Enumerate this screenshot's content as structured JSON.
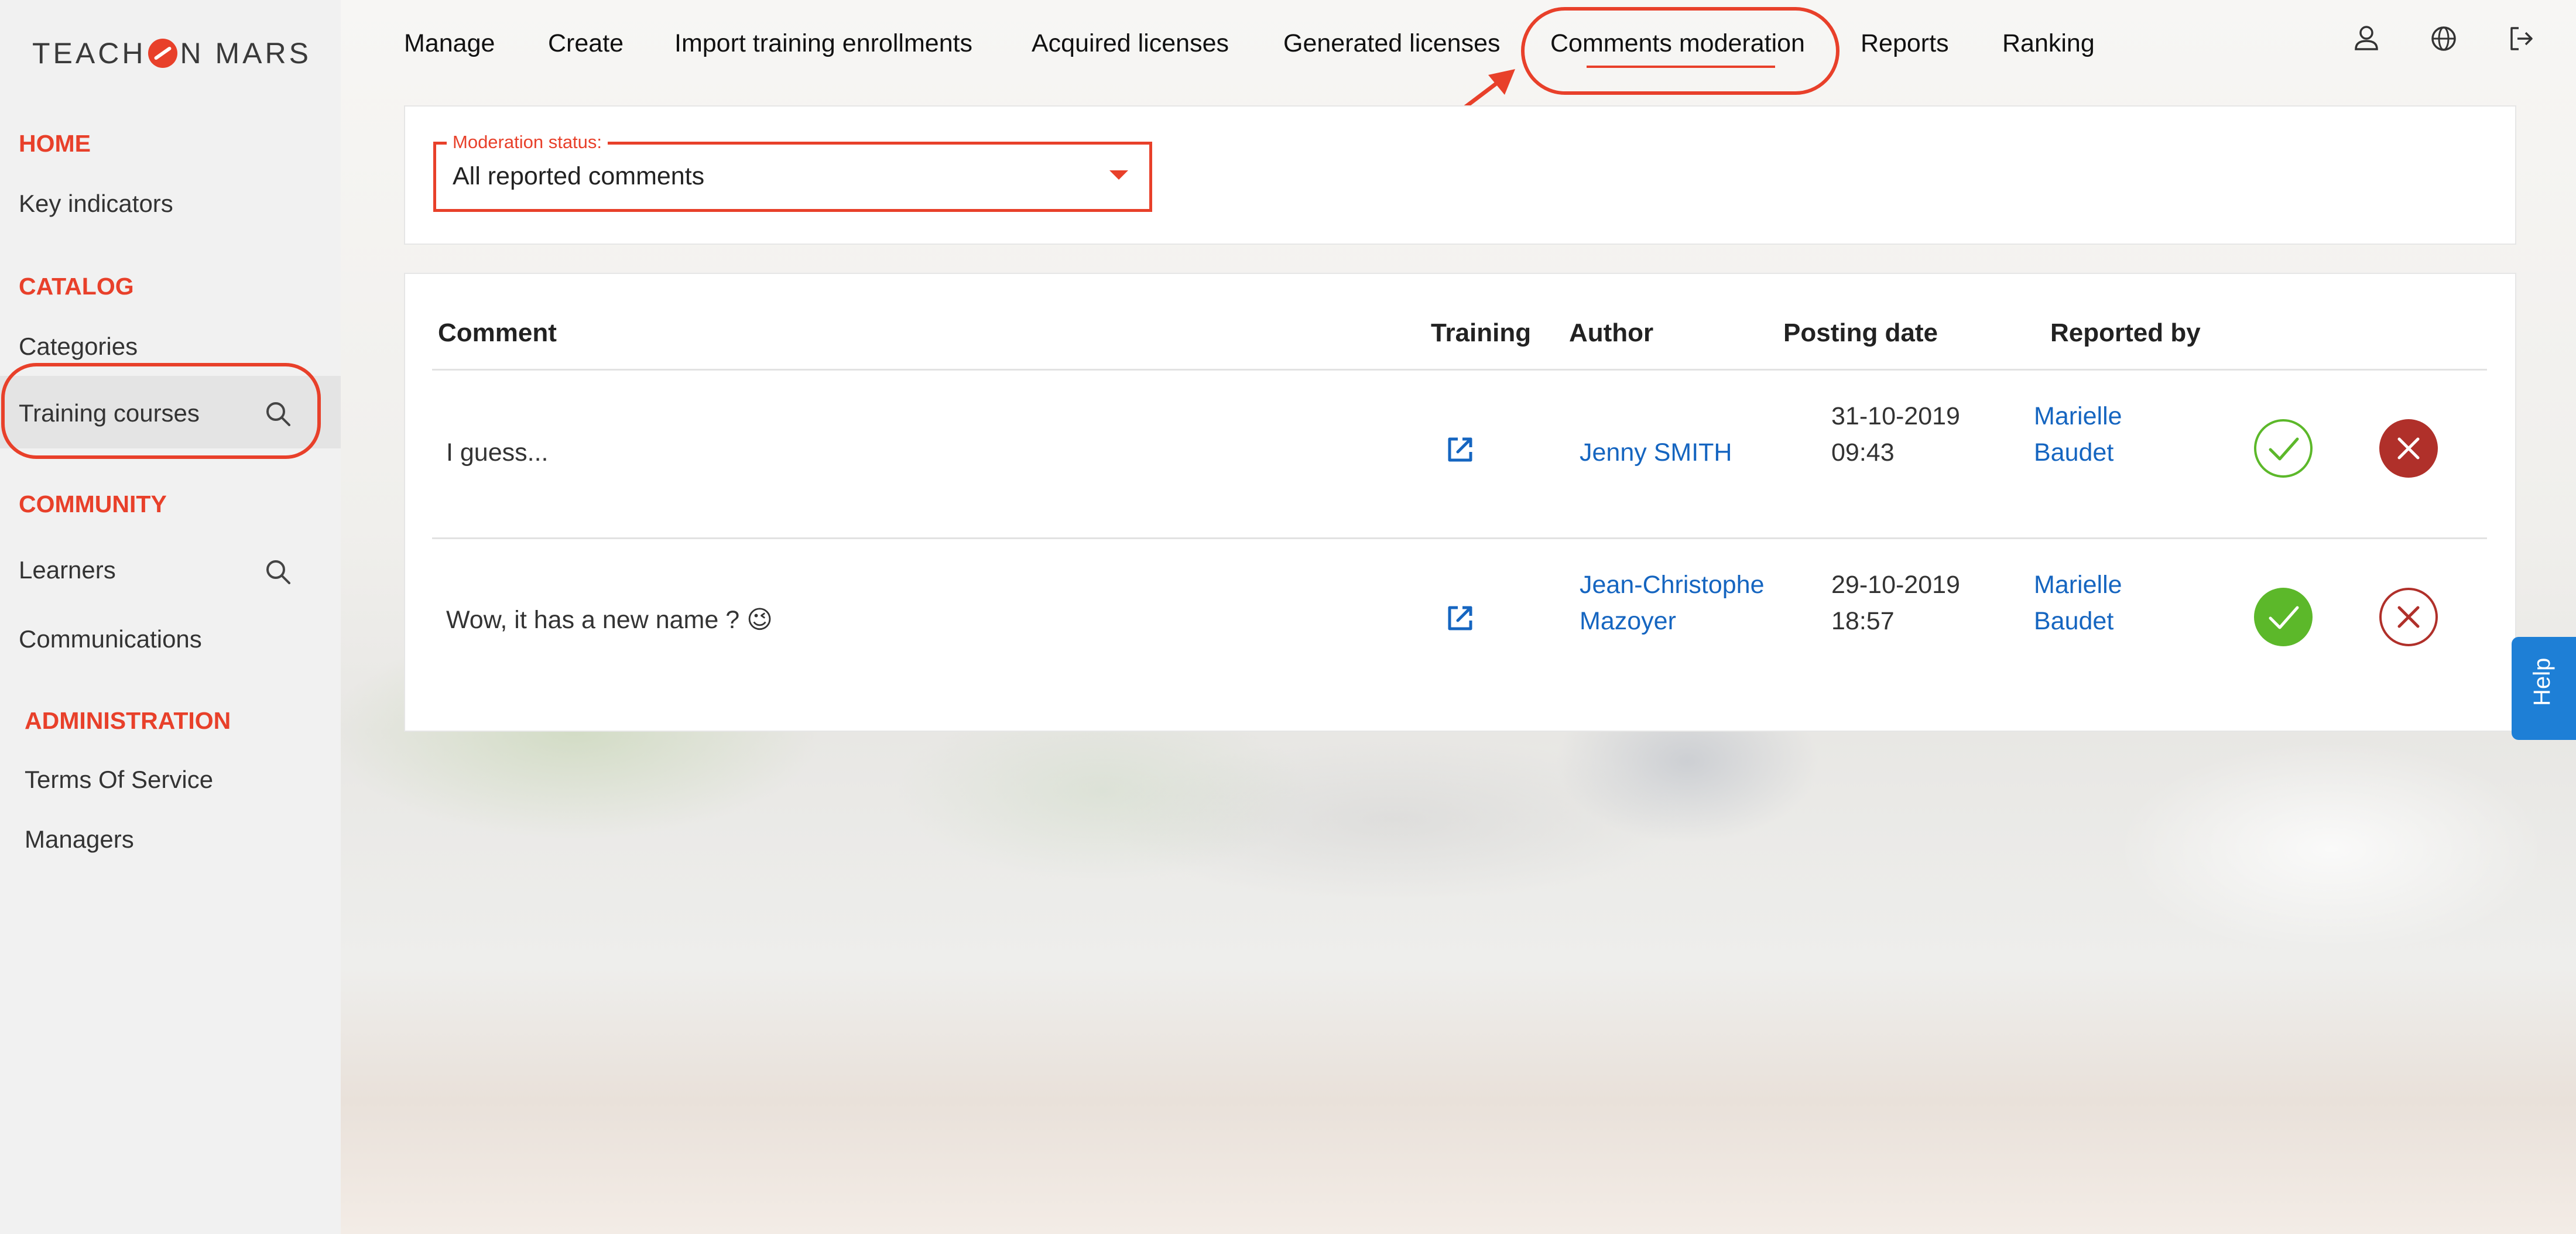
{
  "logo": {
    "part1": "TEACH",
    "part2": "N MARS"
  },
  "sidebar": {
    "sections": [
      {
        "title": "HOME",
        "items": [
          "Key indicators"
        ]
      },
      {
        "title": "CATALOG",
        "items": [
          "Categories",
          "Training courses"
        ]
      },
      {
        "title": "COMMUNITY",
        "items": [
          "Learners",
          "Communications"
        ]
      },
      {
        "title": "ADMINISTRATION",
        "items": [
          "Terms Of Service",
          "Managers"
        ]
      }
    ]
  },
  "topnav": {
    "items": [
      "Manage",
      "Create",
      "Import training enrollments",
      "Acquired licenses",
      "Generated licenses",
      "Comments moderation",
      "Reports",
      "Ranking"
    ],
    "active": "Comments moderation",
    "icons": [
      "user-icon",
      "globe-icon",
      "logout-icon"
    ]
  },
  "filter": {
    "label": "Moderation status:",
    "value": "All reported comments"
  },
  "table": {
    "headers": [
      "Comment",
      "Training",
      "Author",
      "Posting date",
      "Reported by"
    ],
    "rows": [
      {
        "comment": "I guess...",
        "author_line1": "Jenny SMITH",
        "author_line2": "",
        "date": "31-10-2019",
        "time": "09:43",
        "reporter_line1": "Marielle",
        "reporter_line2": "Baudet",
        "approve_state": "outline",
        "reject_state": "filled"
      },
      {
        "comment": "Wow, it has a new name ? 😉",
        "author_line1": "Jean-Christophe",
        "author_line2": "Mazoyer",
        "date": "29-10-2019",
        "time": "18:57",
        "reporter_line1": "Marielle",
        "reporter_line2": "Baudet",
        "approve_state": "filled",
        "reject_state": "outline"
      }
    ]
  },
  "help": {
    "label": "Help"
  },
  "colors": {
    "accent": "#e8402a",
    "link": "#1565c0",
    "approve": "#5cb82a",
    "reject": "#b0302a",
    "help": "#1e7fd6"
  }
}
